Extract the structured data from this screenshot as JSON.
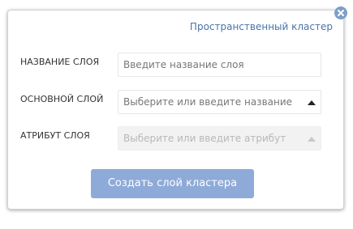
{
  "dialog": {
    "title": "Пространственный кластер",
    "close_icon": "close-icon",
    "submit_label": "Создать слой кластера",
    "accent_color": "#8eaad8"
  },
  "form": {
    "layer_name": {
      "label": "НАЗВАНИЕ СЛОЯ",
      "placeholder": "Введите название слоя"
    },
    "base_layer": {
      "label": "ОСНОВНОЙ СЛОЙ",
      "placeholder": "Выберите или введите название",
      "icon": "caret-up-icon"
    },
    "layer_attribute": {
      "label": "АТРИБУТ СЛОЯ",
      "placeholder": "Выберите или введите атрибут",
      "icon": "caret-up-icon",
      "disabled": true
    }
  }
}
